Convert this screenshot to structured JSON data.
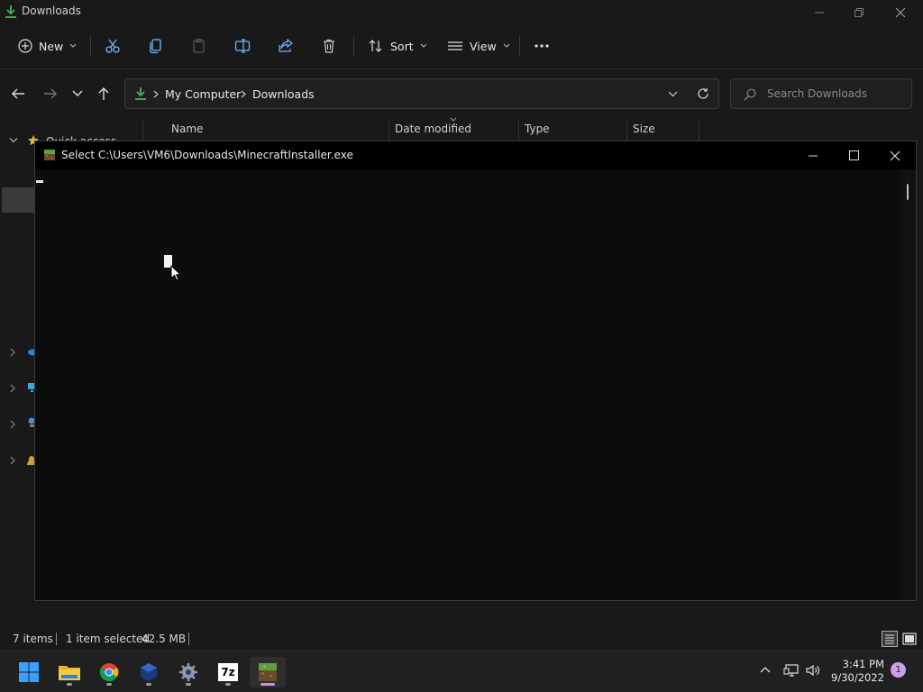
{
  "explorer": {
    "title": "Downloads",
    "toolbar": {
      "new_label": "New",
      "sort_label": "Sort",
      "view_label": "View"
    },
    "address": {
      "crumbs": [
        "My Computer",
        "Downloads"
      ]
    },
    "search": {
      "placeholder": "Search Downloads"
    },
    "columns": [
      "Name",
      "Date modified",
      "Type",
      "Size"
    ],
    "navpane": {
      "quick_access": "Quick access"
    },
    "status": {
      "items": "7 items",
      "selected": "1 item selected",
      "size": "42.5 MB"
    }
  },
  "console": {
    "title": "Select C:\\Users\\VM6\\Downloads\\MinecraftInstaller.exe"
  },
  "taskbar": {
    "apps": [
      "start-icon",
      "file-explorer-icon",
      "chrome-icon",
      "virtualbox-icon",
      "settings-icon",
      "7zip-icon",
      "minecraft-icon"
    ],
    "sevenzip_label": "7z",
    "time": "3:41 PM",
    "date": "9/30/2022",
    "notification_count": "1"
  },
  "colors": {
    "accent": "#d488e8",
    "download_green": "#3fb950"
  }
}
